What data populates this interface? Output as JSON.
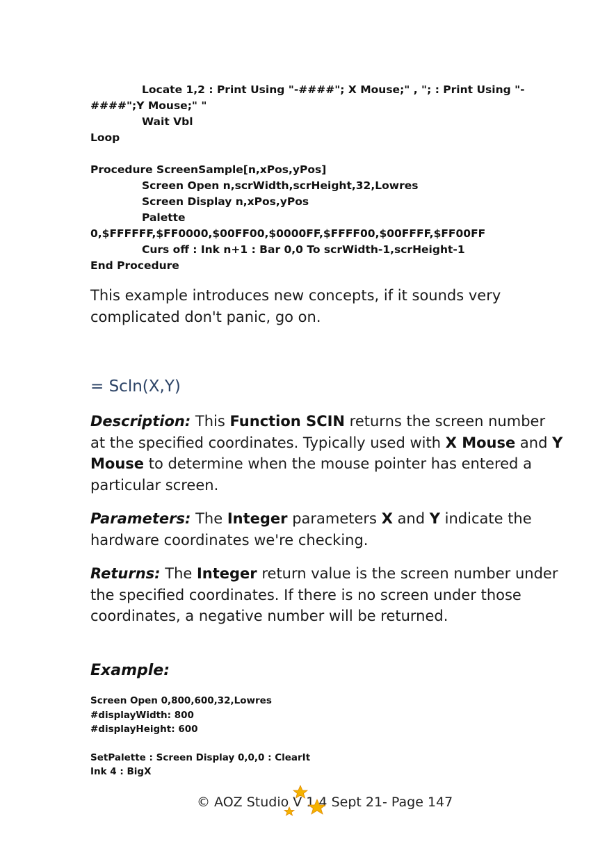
{
  "code_top": {
    "lines": [
      {
        "indent": true,
        "text": "Locate 1,2 : Print Using \"-####\"; X Mouse;\" , \"; : Print Using \"-"
      },
      {
        "indent": false,
        "text": "####\";Y Mouse;\" \""
      },
      {
        "indent": true,
        "text": "Wait Vbl"
      },
      {
        "indent": false,
        "text": "Loop"
      },
      {
        "blank": true
      },
      {
        "indent": false,
        "text": "Procedure ScreenSample[n,xPos,yPos]"
      },
      {
        "indent": true,
        "text": "Screen Open n,scrWidth,scrHeight,32,Lowres"
      },
      {
        "indent": true,
        "text": "Screen Display n,xPos,yPos"
      },
      {
        "indent": true,
        "text": "Palette"
      },
      {
        "indent": false,
        "text": "0,$FFFFFF,$FF0000,$00FF00,$0000FF,$FFFF00,$00FFFF,$FF00FF"
      },
      {
        "indent": true,
        "text": "Curs off : Ink n+1 : Bar 0,0 To scrWidth-1,scrHeight-1"
      },
      {
        "indent": false,
        "text": "End Procedure"
      }
    ]
  },
  "intro": "This example introduces new concepts, if it sounds very complicated don't panic, go on.",
  "heading": "= Scln(X,Y)",
  "description": {
    "label": "Description:",
    "t1": " This ",
    "b1": "Function SCIN",
    "t2": " returns the screen number at the specified coordinates. Typically used with ",
    "b2": "X Mouse",
    "t3": " and ",
    "b3": "Y Mouse",
    "t4": " to determine when the mouse pointer has entered a particular screen."
  },
  "parameters": {
    "label": "Parameters:",
    "t1": " The ",
    "b1": "Integer",
    "t2": " parameters ",
    "b2": "X",
    "t3": " and ",
    "b3": "Y",
    "t4": " indicate the hardware coordinates we're checking."
  },
  "returns": {
    "label": "Returns:",
    "t1": " The ",
    "b1": "Integer",
    "t2": " return value is the screen number under the specified coordinates. If there is no screen under those coordinates, a negative number will be returned."
  },
  "example_heading": "Example:",
  "code_example": {
    "lines": [
      {
        "text": "Screen Open 0,800,600,32,Lowres"
      },
      {
        "text": "#displayWidth: 800"
      },
      {
        "text": "#displayHeight: 600"
      },
      {
        "blank": true
      },
      {
        "text": "SetPalette : Screen Display 0,0,0 : ClearIt"
      },
      {
        "text": "Ink 4 : BigX"
      }
    ]
  },
  "footer": "© AOZ Studio V 1.4 Sept 21- Page 147",
  "colors": {
    "heading": "#2c4366",
    "star": "#f5b300",
    "star_edge": "#e08a00"
  }
}
